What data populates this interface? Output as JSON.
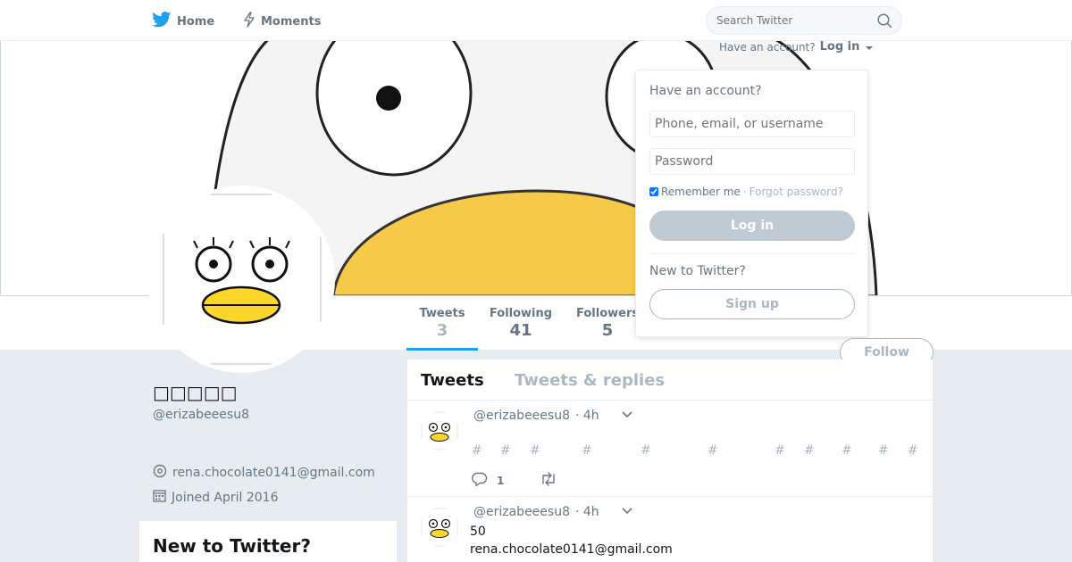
{
  "nav": {
    "home_label": "Home",
    "moments_label": "Moments",
    "search_placeholder": "Search Twitter",
    "brand_color": "#1da1f2"
  },
  "login": {
    "hint_text": "Have an account?",
    "login_link": "Log in",
    "panel_title": "Have an account?",
    "username_placeholder": "Phone, email, or username",
    "password_placeholder": "Password",
    "remember_label": "Remember me",
    "separator": "·",
    "forgot_label": "Forgot password?",
    "login_button": "Log in",
    "new_label": "New to Twitter?",
    "signup_button": "Sign up"
  },
  "profile": {
    "display_name": "□□□□□",
    "screen_name": "@erizabeeesu8",
    "email": "rena.chocolate0141@gmail.com",
    "joined": "Joined April 2016",
    "follow_button": "Follow"
  },
  "stats": {
    "tweets_label": "Tweets",
    "tweets_value": "3",
    "following_label": "Following",
    "following_value": "41",
    "followers_label": "Followers",
    "followers_value": "5"
  },
  "sidebar": {
    "signup_title": "New to Twitter?"
  },
  "timeline": {
    "tab_tweets": "Tweets",
    "tab_replies": "Tweets & replies",
    "tweets": [
      {
        "handle": "@erizabeeesu8",
        "time": "· 4h",
        "hash_symbol": "#",
        "reply_count": "1"
      },
      {
        "handle": "@erizabeeesu8",
        "time": "· 4h",
        "line1": "50",
        "line2": "rena.chocolate0141@gmail.com"
      }
    ]
  },
  "colors": {
    "background": "#e6ecf0",
    "muted_text": "#657786",
    "disabled_button": "#bfcad3",
    "beak_yellow": "#fdd62b"
  }
}
